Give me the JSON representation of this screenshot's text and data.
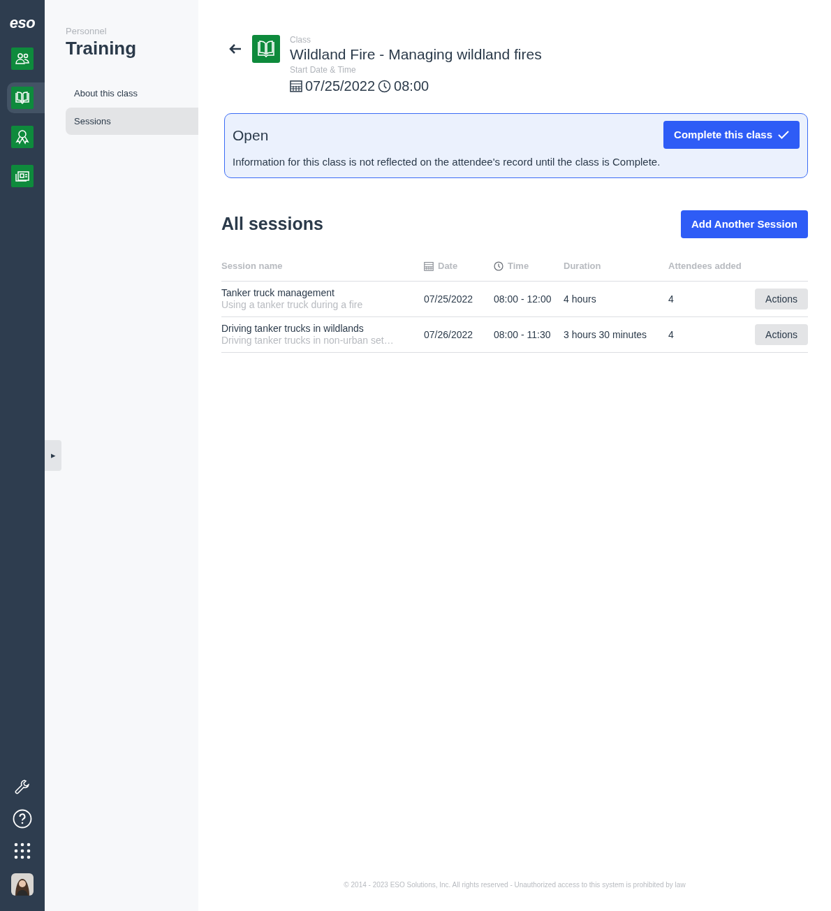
{
  "rail": {
    "logo": "eso",
    "items": [
      {
        "kind": "people",
        "selected": false
      },
      {
        "kind": "book",
        "selected": true
      },
      {
        "kind": "award",
        "selected": false
      },
      {
        "kind": "news",
        "selected": false
      }
    ],
    "bottom": [
      {
        "kind": "wrench"
      },
      {
        "kind": "help"
      },
      {
        "kind": "apps"
      },
      {
        "kind": "avatar"
      }
    ]
  },
  "sidebar": {
    "eyebrow": "Personnel",
    "title": "Training",
    "items": [
      {
        "label": "About this class",
        "selected": false
      },
      {
        "label": "Sessions",
        "selected": true
      }
    ],
    "expand_handle": "▸"
  },
  "header": {
    "eyebrow": "Class",
    "title": "Wildland Fire - Managing wildland fires",
    "date_label": "Start Date & Time",
    "date": "07/25/2022",
    "time": "08:00"
  },
  "status": {
    "title": "Open",
    "button": "Complete this class",
    "message": "Information for this class is not reflected on the attendee's record until the class is Complete."
  },
  "sessions": {
    "title": "All sessions",
    "add_button": "Add Another Session",
    "columns": [
      {
        "label": "Session name",
        "kind": "plain"
      },
      {
        "label": "Date",
        "kind": "calendar"
      },
      {
        "label": "Time",
        "kind": "clock"
      },
      {
        "label": "Duration",
        "kind": "plain"
      },
      {
        "label": "Attendees added",
        "kind": "plain"
      }
    ],
    "rows": [
      {
        "name": "Tanker truck management",
        "description": "Using a tanker truck during a fire",
        "date": "07/25/2022",
        "time": "08:00 - 12:00",
        "duration": "4 hours",
        "attendees": "4",
        "action": "Actions"
      },
      {
        "name": "Driving tanker trucks in wildlands",
        "description": "Driving tanker trucks in non-urban set…",
        "date": "07/26/2022",
        "time": "08:00 - 11:30",
        "duration": "3 hours 30 minutes",
        "attendees": "4",
        "action": "Actions"
      }
    ]
  },
  "footer": "© 2014 - 2023 ESO Solutions, Inc. All rights reserved - Unauthorized access to this system is prohibited by law"
}
